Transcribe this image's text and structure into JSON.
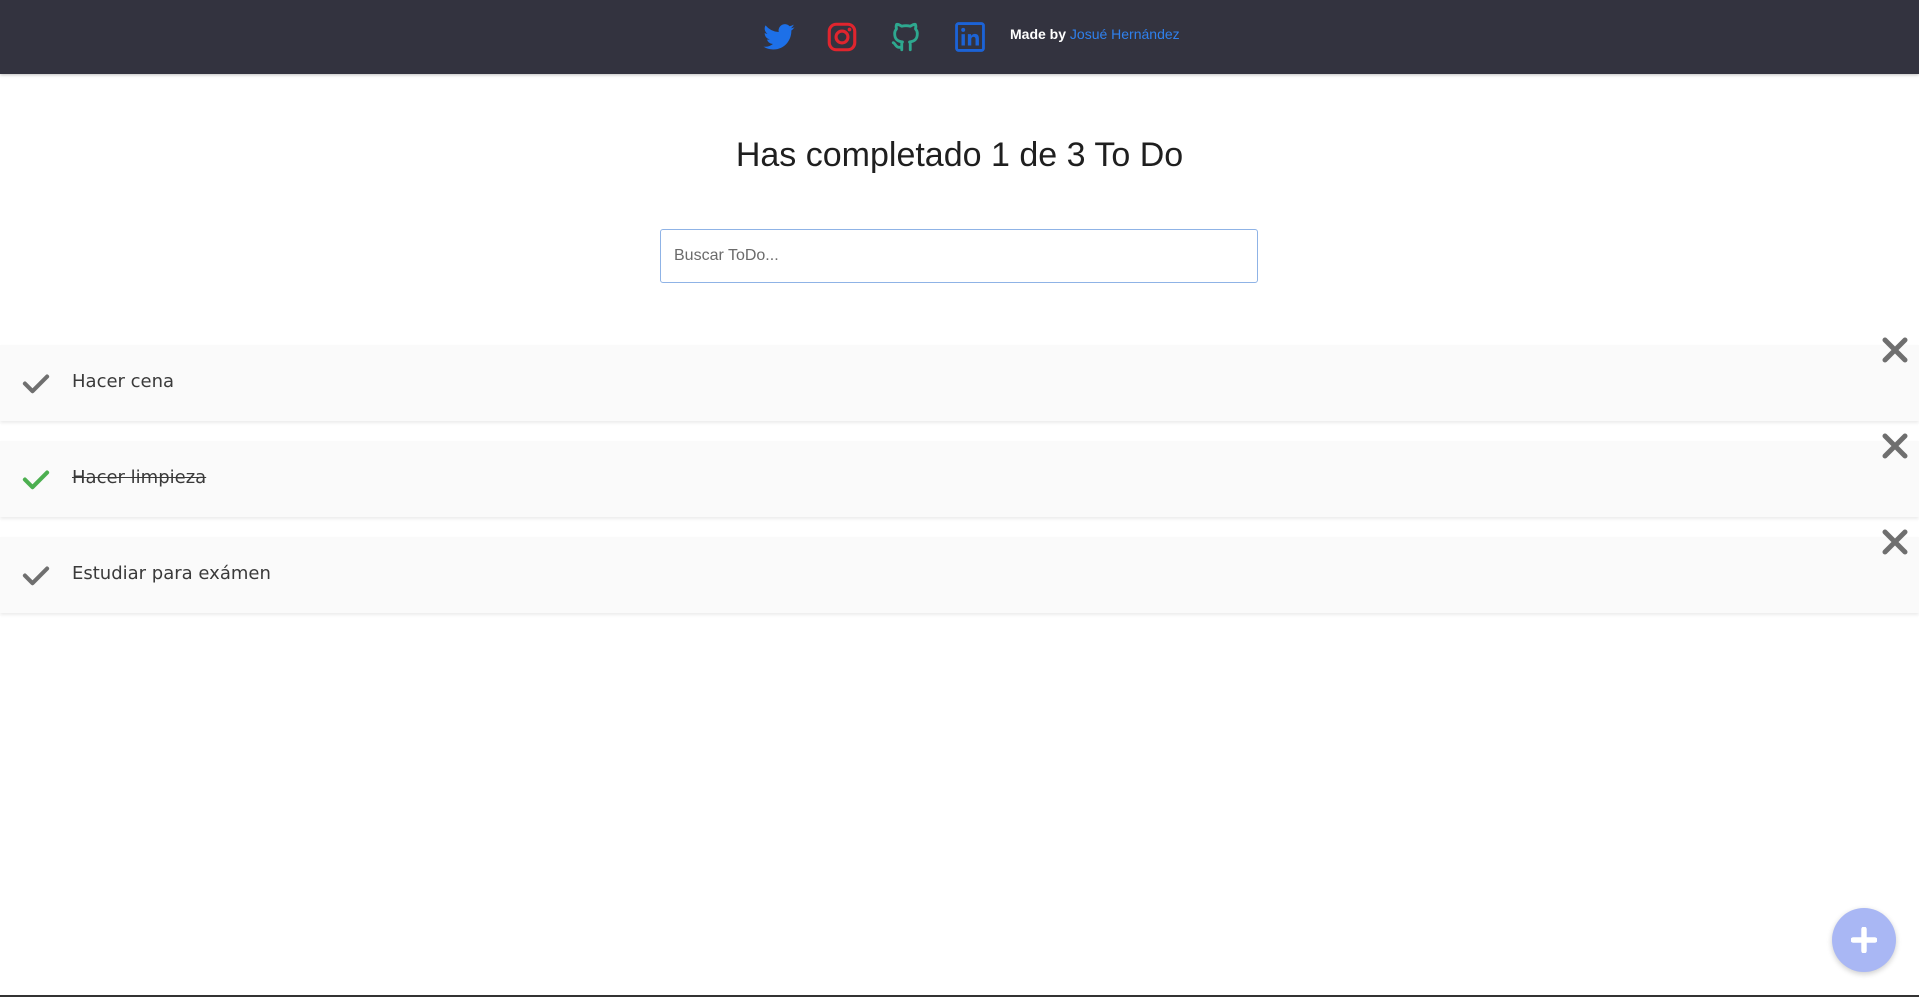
{
  "header": {
    "social": [
      {
        "icon": "twitter-icon",
        "color": "#1d70e8"
      },
      {
        "icon": "instagram-icon",
        "color": "#e0252e"
      },
      {
        "icon": "github-icon",
        "color": "#2ea88f"
      },
      {
        "icon": "linkedin-icon",
        "color": "#1c63d6"
      }
    ],
    "credit_prefix": "Made by",
    "credit_author": "Josué Hernández"
  },
  "main": {
    "title": "Has completado 1 de 3 To Do",
    "search": {
      "placeholder": "Buscar ToDo...",
      "value": ""
    },
    "todos": [
      {
        "text": "Hacer cena",
        "completed": false
      },
      {
        "text": "Hacer limpieza",
        "completed": true
      },
      {
        "text": "Estudiar para exámen",
        "completed": false
      }
    ]
  },
  "colors": {
    "header_bg": "#33333f",
    "check_done": "#4caf50",
    "check_pending": "#6f6f6f",
    "delete": "#6f6f6f",
    "fab": "#a9b7f4",
    "link": "#2f80ed"
  },
  "icons": {
    "check": "check-icon",
    "delete": "close-icon",
    "add": "plus-icon"
  }
}
